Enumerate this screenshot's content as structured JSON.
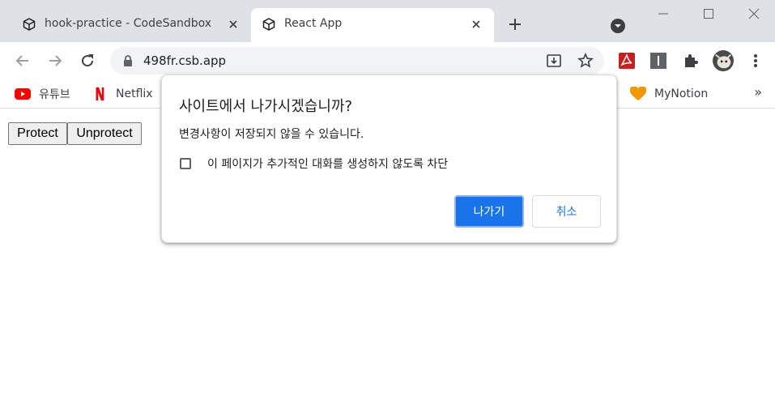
{
  "tabs": [
    {
      "title": "hook-practice - CodeSandbox",
      "icon": "codesandbox-icon",
      "active": false
    },
    {
      "title": "React App",
      "icon": "codesandbox-icon",
      "active": true
    }
  ],
  "address_bar": {
    "url": "498fr.csb.app"
  },
  "bookmarks": [
    {
      "label": "유튜브",
      "icon": "youtube-icon"
    },
    {
      "label": "Netflix",
      "icon": "netflix-icon"
    },
    {
      "label": "MyNotion",
      "icon": "heart-icon"
    }
  ],
  "page": {
    "protect_label": "Protect",
    "unprotect_label": "Unprotect"
  },
  "dialog": {
    "title": "사이트에서 나가시겠습니까?",
    "message": "변경사항이 저장되지 않을 수 있습니다.",
    "checkbox_label": "이 페이지가 추가적인 대화를 생성하지 않도록 차단",
    "checkbox_checked": false,
    "ok_label": "나가기",
    "cancel_label": "취소"
  },
  "colors": {
    "accent": "#1a73e8",
    "tabstrip": "#dee1e6",
    "youtube_red": "#ff0000",
    "netflix_red": "#e50914",
    "pdf_red": "#c5221f",
    "heart_orange": "#f29900"
  }
}
